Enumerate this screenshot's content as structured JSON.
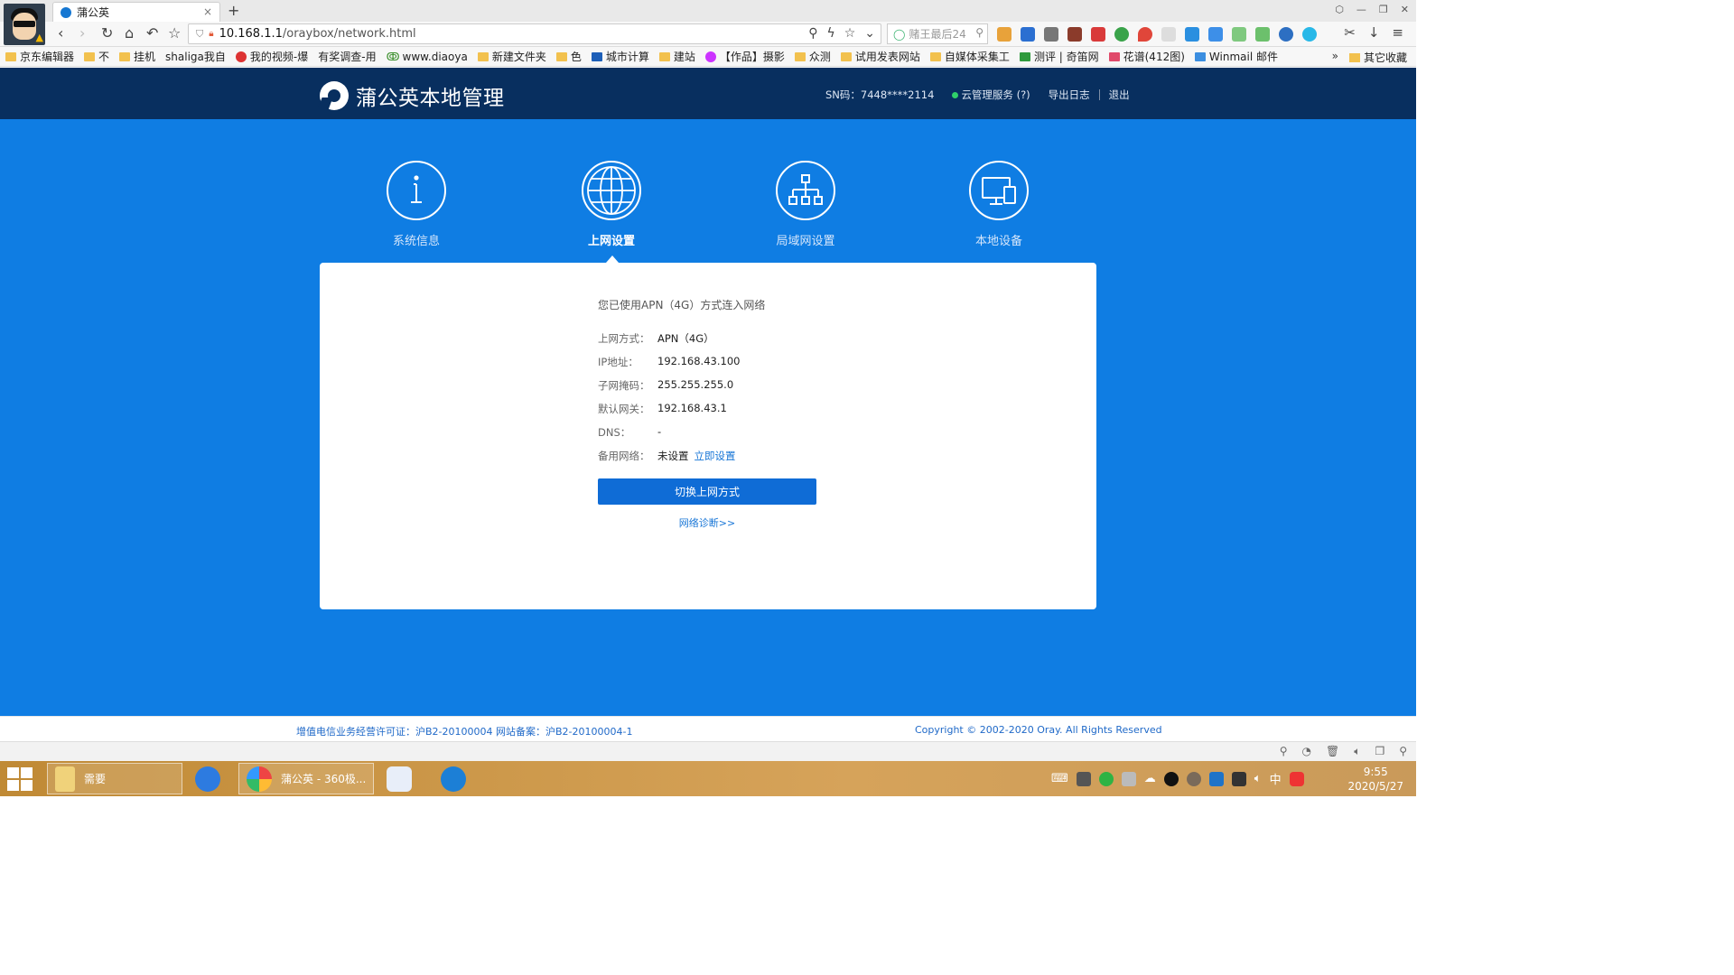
{
  "browser": {
    "tab_title": "蒲公英",
    "tab_close": "×",
    "new_tab": "+",
    "url_host": "10.168.1.1",
    "url_path": "/oraybox/network.html",
    "search_placeholder": "赌王最后24",
    "bookmarks": [
      "京东编辑器",
      "不",
      "挂机",
      "shaliga我自",
      "我的视频-爆",
      "有奖调查-用",
      "www.diaoya",
      "新建文件夹",
      "色",
      "城市计算",
      "建站",
      "【作品】摄影",
      "众测",
      "试用发表网站",
      "自媒体采集工",
      "测评 | 奇笛网",
      "花谱(412图)",
      "Winmail 邮件"
    ],
    "bookmarks_more": "»",
    "bookmarks_other": "其它收藏"
  },
  "header": {
    "brand": "蒲公英本地管理",
    "sn": "SN码：7448****2114",
    "cloud": "云管理服务 (?)",
    "export_log": "导出日志",
    "logout": "退出"
  },
  "nav": [
    {
      "label": "系统信息",
      "icon": "info-icon"
    },
    {
      "label": "上网设置",
      "icon": "globe-icon"
    },
    {
      "label": "局域网设置",
      "icon": "network-tree-icon"
    },
    {
      "label": "本地设备",
      "icon": "devices-icon"
    }
  ],
  "panel": {
    "status": "您已使用APN（4G）方式连入网络",
    "rows": [
      {
        "key": "上网方式：",
        "value": "APN（4G）"
      },
      {
        "key": "IP地址：",
        "value": "192.168.43.100"
      },
      {
        "key": "子网掩码：",
        "value": "255.255.255.0"
      },
      {
        "key": "默认网关：",
        "value": "192.168.43.1"
      },
      {
        "key": "DNS：",
        "value": "-"
      },
      {
        "key": "备用网络：",
        "value": "未设置",
        "link": "立即设置"
      }
    ],
    "switch_button": "切换上网方式",
    "diagnose_link": "网络诊断>>"
  },
  "footer": {
    "license": "增值电信业务经营许可证：沪B2-20100004 网站备案：沪B2-20100004-1",
    "copyright": "Copyright © 2002-2020 Oray. All Rights Reserved"
  },
  "taskbar": {
    "items": [
      "需要",
      "蒲公英 - 360极..."
    ],
    "ime": "中",
    "time": "9:55",
    "date": "2020/5/27"
  },
  "colors": {
    "page_blue": "#0f7de3",
    "header_navy": "#082f5f",
    "button_blue": "#0f6cd6",
    "link_blue": "#1775d6"
  }
}
